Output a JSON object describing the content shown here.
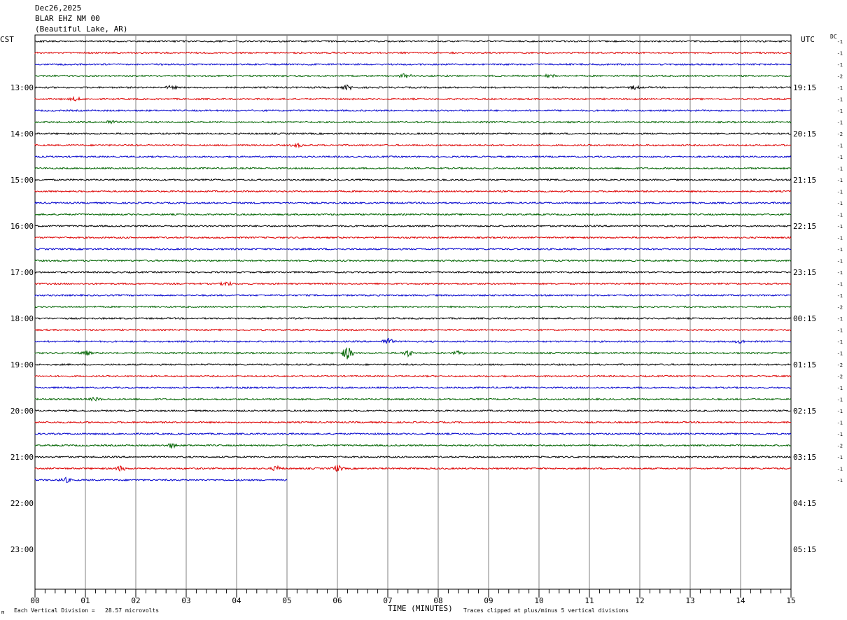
{
  "header": {
    "date": "Dec26,2025",
    "station": "BLAR EHZ NM 00",
    "location": "(Beautiful Lake, AR)"
  },
  "left_zone": "CST",
  "right_zone": "UTC",
  "dc_label": "DC",
  "footer": {
    "scale_note": "Each Vertical Division =   28.57 microvolts",
    "clip_note": "Traces clipped at plus/minus 5 vertical divisions",
    "corner_mark": "m"
  },
  "colors": {
    "black": "#000000",
    "red": "#dd0000",
    "blue": "#0000cc",
    "green": "#006400",
    "grid": "#808080"
  },
  "chart_data": {
    "type": "line",
    "title": "",
    "xlabel": "TIME (MINUTES)",
    "x_ticks": [
      "00",
      "01",
      "02",
      "03",
      "04",
      "05",
      "06",
      "07",
      "08",
      "09",
      "10",
      "11",
      "12",
      "13",
      "14",
      "15"
    ],
    "xlim": [
      0,
      15
    ],
    "trace_color_cycle": [
      "black",
      "red",
      "blue",
      "green"
    ],
    "rows_per_hour": 4,
    "left_time_labels": [
      "13:00",
      "14:00",
      "15:00",
      "16:00",
      "17:00",
      "18:00",
      "19:00",
      "20:00",
      "21:00",
      "22:00",
      "23:00"
    ],
    "right_time_labels": [
      "19:15",
      "20:15",
      "21:15",
      "22:15",
      "23:15",
      "00:15",
      "01:15",
      "02:15",
      "03:15",
      "04:15",
      "05:15"
    ],
    "dc_offsets": [
      -1,
      -1,
      -1,
      -2,
      -1,
      -1,
      -1,
      -1,
      -2,
      -1,
      -1,
      -1,
      -1,
      -1,
      -1,
      -1,
      -1,
      -1,
      -1,
      -1,
      -1,
      -1,
      -1,
      -2,
      -1,
      -1,
      -1,
      -1,
      -2,
      -2,
      -1,
      -1,
      -1,
      -1,
      -1,
      -2,
      -1,
      -1,
      -1
    ],
    "trace_count": 39,
    "last_trace_end_minute": 5,
    "events": [
      {
        "trace": 3,
        "minute": 7.35,
        "amplitude": 3
      },
      {
        "trace": 3,
        "minute": 10.2,
        "amplitude": 2
      },
      {
        "trace": 4,
        "minute": 2.7,
        "amplitude": 2
      },
      {
        "trace": 4,
        "minute": 6.2,
        "amplitude": 2.5
      },
      {
        "trace": 4,
        "minute": 11.9,
        "amplitude": 2
      },
      {
        "trace": 5,
        "minute": 0.8,
        "amplitude": 2
      },
      {
        "trace": 7,
        "minute": 1.5,
        "amplitude": 2
      },
      {
        "trace": 9,
        "minute": 5.2,
        "amplitude": 2
      },
      {
        "trace": 21,
        "minute": 3.8,
        "amplitude": 2.5
      },
      {
        "trace": 26,
        "minute": 7.0,
        "amplitude": 4
      },
      {
        "trace": 26,
        "minute": 14.0,
        "amplitude": 2
      },
      {
        "trace": 27,
        "minute": 1.0,
        "amplitude": 3
      },
      {
        "trace": 27,
        "minute": 6.2,
        "amplitude": 8
      },
      {
        "trace": 27,
        "minute": 7.4,
        "amplitude": 4
      },
      {
        "trace": 27,
        "minute": 8.4,
        "amplitude": 2
      },
      {
        "trace": 31,
        "minute": 1.2,
        "amplitude": 2
      },
      {
        "trace": 35,
        "minute": 2.7,
        "amplitude": 3
      },
      {
        "trace": 37,
        "minute": 1.7,
        "amplitude": 3
      },
      {
        "trace": 37,
        "minute": 4.8,
        "amplitude": 3
      },
      {
        "trace": 37,
        "minute": 6.0,
        "amplitude": 4
      },
      {
        "trace": 38,
        "minute": 0.6,
        "amplitude": 3
      },
      {
        "trace": 38,
        "minute": 6.8,
        "amplitude": 3
      },
      {
        "trace": 38,
        "minute": 11.5,
        "amplitude": 3
      },
      {
        "trace": 40,
        "minute": 10.7,
        "amplitude": 4
      },
      {
        "trace": 40,
        "minute": 12.9,
        "amplitude": 2
      }
    ]
  }
}
